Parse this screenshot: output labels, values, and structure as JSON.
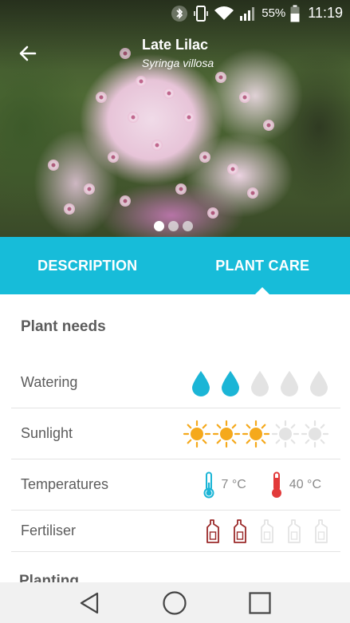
{
  "status_bar": {
    "icons": [
      "bluetooth-icon",
      "vibrate-icon",
      "wifi-icon",
      "signal-icon",
      "battery-icon"
    ],
    "battery_percent": "55%",
    "time": "11:19"
  },
  "header": {
    "title": "Late Lilac",
    "subtitle": "Syringa villosa",
    "back_icon": "arrow-left-icon",
    "image_pager": {
      "count": 3,
      "active_index": 0
    }
  },
  "tabs": [
    {
      "label": "DESCRIPTION",
      "active": false
    },
    {
      "label": "PLANT CARE",
      "active": true
    }
  ],
  "plant_needs": {
    "title": "Plant needs",
    "rows": [
      {
        "label": "Watering",
        "icon": "water-drop-icon",
        "level": 2,
        "max": 5
      },
      {
        "label": "Sunlight",
        "icon": "sun-icon",
        "level": 3,
        "max": 5
      },
      {
        "label": "Temperatures",
        "min": "7 °C",
        "max": "40 °C"
      },
      {
        "label": "Fertiliser",
        "icon": "fertiliser-bottle-icon",
        "level": 2,
        "max": 5
      }
    ]
  },
  "next_section_title": "Planting",
  "colors": {
    "accent": "#17bcd9",
    "water_active": "#1bb5d6",
    "inactive": "#e3e3e3",
    "sun_active": "#f5a91c",
    "fertiliser_active": "#9b2a2a",
    "temp_cold": "#1bb5d6",
    "temp_hot": "#e23a3a"
  },
  "nav_bar": [
    "back-triangle-icon",
    "home-circle-icon",
    "recents-square-icon"
  ]
}
